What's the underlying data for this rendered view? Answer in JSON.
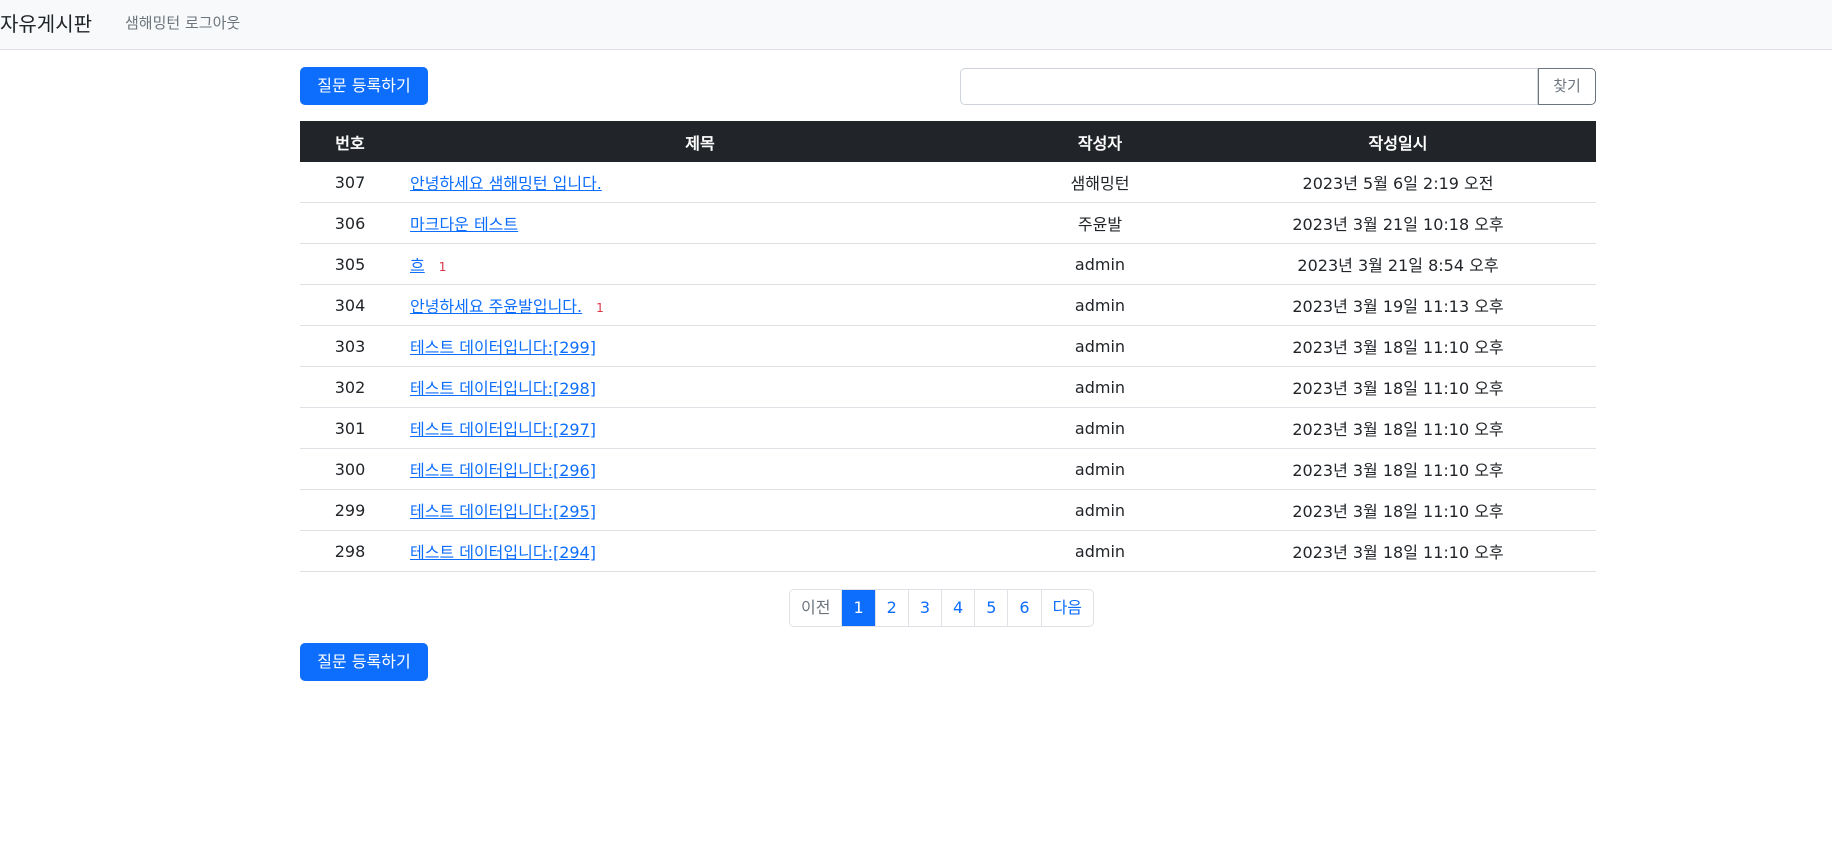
{
  "navbar": {
    "brand": "자유게시판",
    "links": [
      "샘해밍턴 로그아웃"
    ]
  },
  "toolbar": {
    "create_label": "질문 등록하기",
    "search_value": "",
    "search_button": "찾기"
  },
  "table": {
    "headers": [
      "번호",
      "제목",
      "작성자",
      "작성일시"
    ],
    "rows": [
      {
        "no": "307",
        "title": "안녕하세요 샘해밍턴 입니다.",
        "badge": "",
        "author": "샘해밍턴",
        "date": "2023년 5월 6일 2:19 오전"
      },
      {
        "no": "306",
        "title": "마크다운 테스트",
        "badge": "",
        "author": "주윤발",
        "date": "2023년 3월 21일 10:18 오후"
      },
      {
        "no": "305",
        "title": "흐",
        "badge": "1",
        "author": "admin",
        "date": "2023년 3월 21일 8:54 오후"
      },
      {
        "no": "304",
        "title": "안녕하세요 주윤발입니다.",
        "badge": "1",
        "author": "admin",
        "date": "2023년 3월 19일 11:13 오후"
      },
      {
        "no": "303",
        "title": "테스트 데이터입니다:[299]",
        "badge": "",
        "author": "admin",
        "date": "2023년 3월 18일 11:10 오후"
      },
      {
        "no": "302",
        "title": "테스트 데이터입니다:[298]",
        "badge": "",
        "author": "admin",
        "date": "2023년 3월 18일 11:10 오후"
      },
      {
        "no": "301",
        "title": "테스트 데이터입니다:[297]",
        "badge": "",
        "author": "admin",
        "date": "2023년 3월 18일 11:10 오후"
      },
      {
        "no": "300",
        "title": "테스트 데이터입니다:[296]",
        "badge": "",
        "author": "admin",
        "date": "2023년 3월 18일 11:10 오후"
      },
      {
        "no": "299",
        "title": "테스트 데이터입니다:[295]",
        "badge": "",
        "author": "admin",
        "date": "2023년 3월 18일 11:10 오후"
      },
      {
        "no": "298",
        "title": "테스트 데이터입니다:[294]",
        "badge": "",
        "author": "admin",
        "date": "2023년 3월 18일 11:10 오후"
      }
    ]
  },
  "pagination": {
    "prev": "이전",
    "pages": [
      "1",
      "2",
      "3",
      "4",
      "5",
      "6"
    ],
    "active": "1",
    "next": "다음"
  },
  "colors": {
    "primary": "#0d6efd",
    "header_bg": "#212529",
    "badge": "#dc3545",
    "navbar_bg": "#f8f9fa"
  }
}
